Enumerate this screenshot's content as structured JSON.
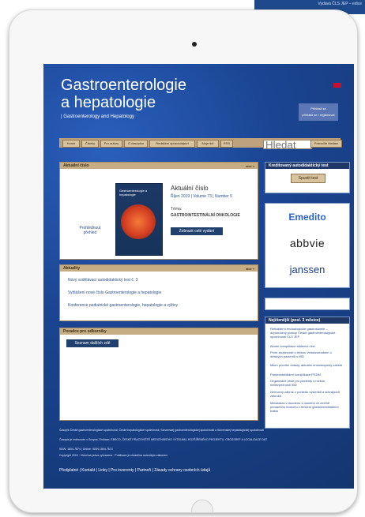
{
  "background_corner": {
    "text": "Vydává ČLS JEP – edice"
  },
  "site": {
    "title_line1": "Gastroenterologie",
    "title_line2": "a hepatologie",
    "subtitle": "| Gastroenterology and Hepatology",
    "login_line1": "Přihlásit se",
    "login_line2": "přihlásit se / registrovat"
  },
  "nav": {
    "items": [
      "Home",
      "Články",
      "Pro autory",
      "O časopisu",
      "Redakční zpravodajství",
      "Moje šílí",
      "RSS"
    ],
    "search_placeholder": "Hledat",
    "search_button": "Pokročilé hledání"
  },
  "current_issue": {
    "header": "Aktuální číslo",
    "more": "více »",
    "cover_title": "Gastroenterologie a hepatologie",
    "preview_label": "Prohlédnout přehled",
    "title": "Aktuální číslo",
    "date": "Říjen 2019 | Volume 73 | Number 5",
    "topic_label": "Téma:",
    "topic": "GASTROINTESTINÁLNÍ ONKOLOGIE",
    "show_all": "Zobrazit celé vydání"
  },
  "news": {
    "header": "Aktuality",
    "more": "více »",
    "items": [
      "Nový vzdělávací autodidaktický test č. 3",
      "Vyhlášení nové číslo Gastroenterologie a hepatologie",
      "Konference pediatrické gastroenterologie, hepatologie a výživy"
    ]
  },
  "reviewers": {
    "header": "Poradce pro odborníky",
    "button": "Seznam dalších zdě"
  },
  "sidebar": {
    "test_header": "Kreditovaný autodidaktický test",
    "test_button": "Spustit test",
    "partners": [
      "Emedito",
      "abbvie",
      "janssen"
    ],
    "most_read_header": "Nejčtenější (posl. 3 měsíce)",
    "most_read": [
      "Refraktérní endoskopické gastrostomie – doporučený postup České gastroenterologické společnosti ČLS JEP",
      "Akutní komplikace biliárních lézí",
      "První zkušenosti s léčbou vedolizumabem u dětských pacientů s IBD",
      "Mikro prioritní dotazy, aktuální endoskopický zákrok",
      "Pankreatobiliární komplikace PSDM",
      "Organizace péče pro pacienty s nízkou nebezpečností IBD",
      "Nemocný zákrok z pohledu výsledků a stávajících zákroků",
      "Metastáza v duodenu s duodeni ve změně primárního bronchu v tenkém gastrointestinálním traktu"
    ]
  },
  "footer": {
    "lines": [
      "Časopis České gastroenterologické společnosti, České hepatologické společnosti, Slovenskej gastroenterologickej spoločnosti a Slovenskej hepatologickej spoločnosti",
      "Časopis je indexován v Scopus, Embase, EBSCO, ČESKÉ PRACOVIŠTĚ MEDICÍNSKÉHO VÝZKUMU, ROZŠÍŘENÉHO PROJEKTU, CROSSREF A LOCALIZACE DAT",
      "ISSN: 1804-7874 | Online: ISSN 1804-7874",
      "Copyright 2019 · Všechna práva vyhrazena · Publikace je chráněna autorským zákonem"
    ],
    "bottom_nav": [
      "Předplatné",
      "Kontakt",
      "Linky",
      "Pro inzerenty",
      "Partneři",
      "Zásady ochrany osobních údajů"
    ]
  },
  "colors": {
    "site_blue": "#1b3f88",
    "nav_tan": "#bda27d",
    "panel_header": "#c7ad83",
    "button_blue": "#20406e",
    "side_header": "#1f3868"
  }
}
